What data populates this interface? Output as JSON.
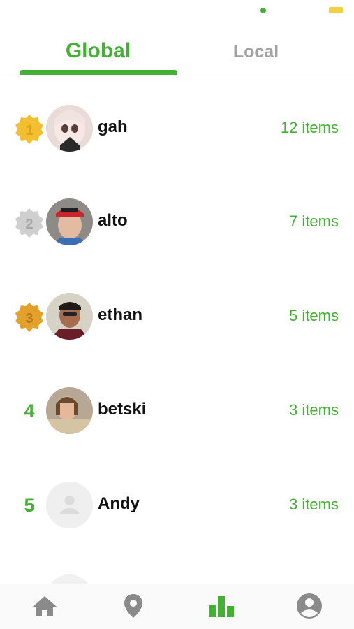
{
  "tabs": [
    {
      "label": "Global",
      "active": true
    },
    {
      "label": "Local",
      "active": false
    }
  ],
  "leaderboard": [
    {
      "rank": "1",
      "badge": "gold-medal-icon",
      "name": "gah",
      "count": "12 items",
      "avatar": "photo-avatar"
    },
    {
      "rank": "2",
      "badge": "silver-medal-icon",
      "name": "alto",
      "count": "7 items",
      "avatar": "photo-avatar"
    },
    {
      "rank": "3",
      "badge": "bronze-medal-icon",
      "name": "ethan",
      "count": "5 items",
      "avatar": "photo-avatar"
    },
    {
      "rank": "4",
      "badge": "",
      "name": "betski",
      "count": "3 items",
      "avatar": "photo-avatar"
    },
    {
      "rank": "5",
      "badge": "",
      "name": "Andy",
      "count": "3 items",
      "avatar": "default-user-avatar"
    }
  ],
  "bottom_nav": [
    {
      "icon": "home-icon",
      "active": false
    },
    {
      "icon": "location-pin-icon",
      "active": false
    },
    {
      "icon": "leaderboard-chart-icon",
      "active": true
    },
    {
      "icon": "account-circle-icon",
      "active": false
    }
  ],
  "colors": {
    "accent": "#45b035",
    "inactive": "#a3a3a3",
    "gold": "#f3be2f",
    "silver": "#c8c8c8",
    "bronze": "#e3a12b",
    "nav_icon": "#8a8a8a"
  }
}
